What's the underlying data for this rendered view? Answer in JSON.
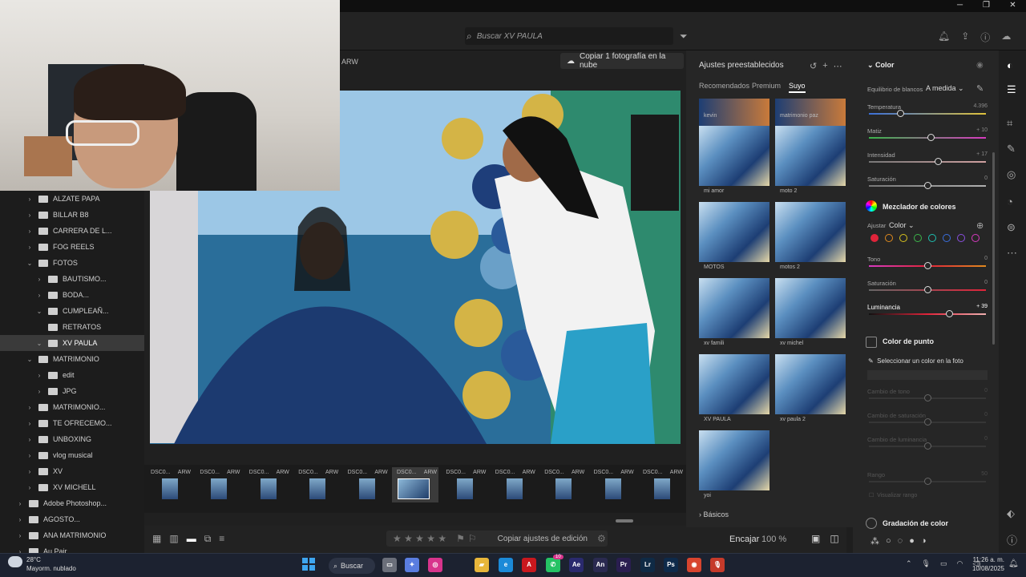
{
  "window": {
    "minimize": "─",
    "maximize": "❐",
    "close": "✕"
  },
  "search": {
    "placeholder": "Buscar XV PAULA",
    "icon": "search-icon"
  },
  "center": {
    "filename_label": "ARW",
    "copy_cloud_label": "Copiar 1 fotografía en la nube"
  },
  "folders": [
    {
      "label": "ALZATE PAPA",
      "indent": 1,
      "expanded": false
    },
    {
      "label": "BILLAR B8",
      "indent": 1,
      "expanded": false
    },
    {
      "label": "CARRERA DE L...",
      "indent": 1,
      "expanded": false
    },
    {
      "label": "FOG REELS",
      "indent": 1,
      "expanded": false
    },
    {
      "label": "FOTOS",
      "indent": 1,
      "expanded": true
    },
    {
      "label": "BAUTISMO...",
      "indent": 2,
      "expanded": false
    },
    {
      "label": "BODA...",
      "indent": 2,
      "expanded": false
    },
    {
      "label": "CUMPLEAÑ...",
      "indent": 2,
      "expanded": true
    },
    {
      "label": "RETRATOS",
      "indent": 2,
      "expanded": false,
      "nochev": true
    },
    {
      "label": "XV PAULA",
      "indent": 2,
      "expanded": true,
      "selected": true
    },
    {
      "label": "MATRIMONIO",
      "indent": 1,
      "expanded": true
    },
    {
      "label": "edit",
      "indent": 2,
      "expanded": false
    },
    {
      "label": "JPG",
      "indent": 2,
      "expanded": false
    },
    {
      "label": "MATRIMONIO...",
      "indent": 1,
      "expanded": false
    },
    {
      "label": "TE OFRECEMO...",
      "indent": 1,
      "expanded": false
    },
    {
      "label": "UNBOXING",
      "indent": 1,
      "expanded": false
    },
    {
      "label": "vlog musical",
      "indent": 1,
      "expanded": false
    },
    {
      "label": "XV",
      "indent": 1,
      "expanded": false
    },
    {
      "label": "XV MICHELL",
      "indent": 1,
      "expanded": false
    },
    {
      "label": "Adobe Photoshop...",
      "indent": 0,
      "expanded": false
    },
    {
      "label": "AGOSTO...",
      "indent": 0,
      "expanded": false
    },
    {
      "label": "ANA MATRIMONIO",
      "indent": 0,
      "expanded": false
    },
    {
      "label": "Au Pair",
      "indent": 0,
      "expanded": false
    }
  ],
  "filmstrip": {
    "thumbs": [
      {
        "name": "DSC0...",
        "ext": "ARW"
      },
      {
        "name": "DSC0...",
        "ext": "ARW"
      },
      {
        "name": "DSC0...",
        "ext": "ARW"
      },
      {
        "name": "DSC0...",
        "ext": "ARW"
      },
      {
        "name": "DSC0...",
        "ext": "ARW"
      },
      {
        "name": "DSC0...",
        "ext": "ARW",
        "selected": true
      },
      {
        "name": "DSC0...",
        "ext": "ARW"
      },
      {
        "name": "DSC0...",
        "ext": "ARW"
      },
      {
        "name": "DSC0...",
        "ext": "ARW"
      },
      {
        "name": "DSC0...",
        "ext": "ARW"
      },
      {
        "name": "DSC0...",
        "ext": "ARW"
      }
    ]
  },
  "bottom": {
    "stars": "★ ★ ★ ★ ★",
    "copy_edit_label": "Copiar ajustes de edición",
    "fit_label": "Encajar",
    "zoom_label": "100 %"
  },
  "presets": {
    "title": "Ajustes preestablecidos",
    "tabs": [
      "Recomendados",
      "Premium",
      "Suyo"
    ],
    "active_tab": "Suyo",
    "items": [
      "kevin",
      "matrimonio paz",
      "mi amor",
      "moto 2",
      "MOTOS",
      "motos 2",
      "xv famili",
      "xv michel",
      "XV PAULA",
      "xv paula 2",
      "yoi"
    ],
    "basics_label": "Básicos"
  },
  "edit": {
    "color_title": "Color",
    "wb_label": "Equilibrio de blancos",
    "wb_value": "A medida",
    "temp_label": "Temperatura",
    "temp_value": "4.396",
    "tint_label": "Matiz",
    "tint_value": "+ 10",
    "vib_label": "Intensidad",
    "vib_value": "+ 17",
    "sat_label": "Saturación",
    "sat_value": "0",
    "mixer_title": "Mezclador de colores",
    "adjust_label": "Ajustar",
    "adjust_value": "Color",
    "swatches": [
      "#e0243a",
      "#e08a1e",
      "#d8c21e",
      "#3cb44a",
      "#1ebfb0",
      "#3a6fe0",
      "#8a4fe0",
      "#d83ac0"
    ],
    "hue_label": "Tono",
    "hue_value": "0",
    "msat_label": "Saturación",
    "msat_value": "0",
    "lum_label": "Luminancia",
    "lum_value": "+ 39",
    "point_title": "Color de punto",
    "pick_label": "Seleccionar un color en la foto",
    "hue_shift_label": "Cambio de tono",
    "hue_shift_value": "0",
    "sat_shift_label": "Cambio de saturación",
    "sat_shift_value": "0",
    "lum_shift_label": "Cambio de luminancia",
    "lum_shift_value": "0",
    "range_label": "Rango",
    "range_value": "50",
    "visualize_label": "Visualizar rango",
    "grading_title": "Gradación de color"
  },
  "taskbar": {
    "temp": "28°C",
    "weather": "Mayorm. nublado",
    "search_label": "Buscar",
    "apps": [
      {
        "name": "files",
        "label": "▭",
        "color": "#6b6f7a"
      },
      {
        "name": "copilot",
        "label": "✦",
        "color": "#5a7de0"
      },
      {
        "name": "instagram",
        "label": "◎",
        "color": "#d8348c"
      },
      {
        "name": "explorer",
        "label": "▰",
        "color": "#e8b63a"
      },
      {
        "name": "edge",
        "label": "e",
        "color": "#1b8ad8"
      },
      {
        "name": "acrobat",
        "label": "A",
        "color": "#c9181e"
      },
      {
        "name": "whatsapp",
        "label": "✆",
        "color": "#25c264"
      },
      {
        "name": "aftereffects",
        "label": "Ae",
        "color": "#2a2a6e"
      },
      {
        "name": "animate",
        "label": "An",
        "color": "#2a2a50"
      },
      {
        "name": "premiere",
        "label": "Pr",
        "color": "#2a1e50"
      },
      {
        "name": "lightroom",
        "label": "Lr",
        "color": "#0f2a45"
      },
      {
        "name": "photoshop",
        "label": "Ps",
        "color": "#0e2a4a"
      },
      {
        "name": "chrome",
        "label": "◉",
        "color": "#d8442e"
      },
      {
        "name": "mic",
        "label": "🎙",
        "color": "#c53a2a"
      }
    ],
    "whatsapp_badge": "10",
    "time": "11:26 a. m.",
    "date": "10/08/2025"
  }
}
